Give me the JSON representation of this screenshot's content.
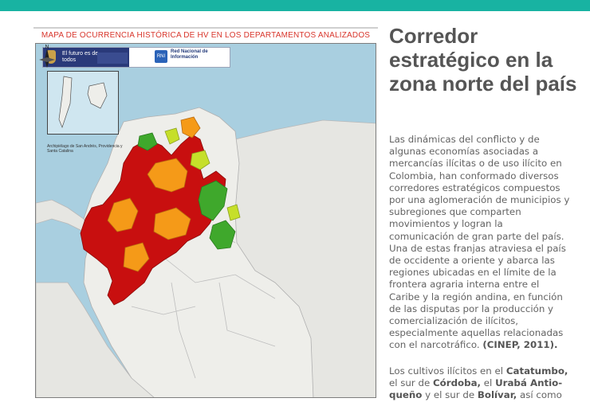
{
  "map": {
    "title": "MAPA DE OCURRENCIA HISTÓRICA DE HV EN LOS DEPARTAMENTOS ANALIZADOS",
    "logo_slogan": "El futuro es de todos",
    "logo_gov": "Gobierno de Colombia",
    "logo_rni_name": "Red Nacional de Información",
    "inset_caption": "Archipiélago de San Andrés, Providencia y Santa Catalina",
    "compass_label": "N",
    "colors": {
      "sea": "#a9cfe0",
      "land": "#eeeeea",
      "high": "#c80f0f",
      "medium": "#f59a18",
      "low": "#3fa82c",
      "minimal": "#c6df2a"
    }
  },
  "article": {
    "heading": "Corredor estratégico en la zona norte del país",
    "paragraph_1": "Las dinámicas del conflicto y de algunas economías asociadas a mercancías ilícitas o de uso ilícito en Colombia, han conformado diversos corredores estratégicos compuestos por una aglomeración de municipios y subregiones que comparten movimientos y logran la comunicación de gran parte del país. Una de estas franjas atraviesa el país de occidente a oriente y abarca las regiones ubicadas en el límite de la frontera agraria interna entre el Caribe y la región andina, en función de las disputas por la producción y comercialización de ilícitos, especialmente aquellas relacionadas con el narcotráfico.",
    "citation": "(CINEP, 2011).",
    "p2_prefix": "Los cultivos ilícitos en el ",
    "p2_catatumbo": "Catatumbo,",
    "p2_mid1": " el sur de ",
    "p2_cordoba": "Córdoba,",
    "p2_mid2": " el ",
    "p2_uraba": "Urabá Antio-queño",
    "p2_mid3": " y el sur de ",
    "p2_bolivar": "Bolívar,",
    "p2_tail": " así como"
  }
}
